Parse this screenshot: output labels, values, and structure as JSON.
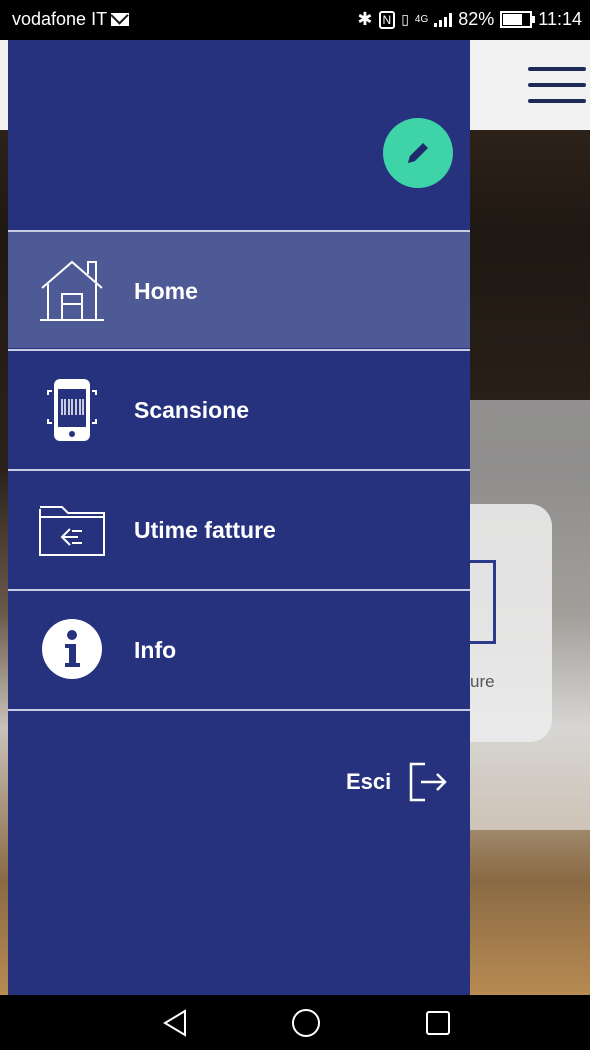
{
  "status_bar": {
    "carrier": "vodafone IT",
    "network": "4G",
    "battery": "82%",
    "time": "11:14"
  },
  "background": {
    "card_label": "ure"
  },
  "drawer": {
    "menu": [
      {
        "label": "Home",
        "icon": "home-icon",
        "active": true
      },
      {
        "label": "Scansione",
        "icon": "barcode-scan-icon",
        "active": false
      },
      {
        "label": "Utime fatture",
        "icon": "folder-back-icon",
        "active": false
      },
      {
        "label": "Info",
        "icon": "info-icon",
        "active": false
      }
    ],
    "logout_label": "Esci"
  },
  "colors": {
    "drawer_bg": "#27327f",
    "active_item_bg": "#4e5a95",
    "edit_button": "#3ed4a7"
  }
}
